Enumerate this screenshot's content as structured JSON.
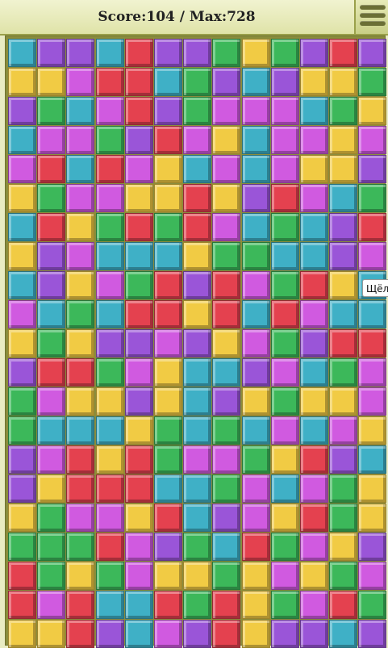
{
  "header": {
    "score_text": "Score:104 / Max:728"
  },
  "menu": {
    "icon": "hamburger-menu-icon"
  },
  "tooltip": {
    "text": "Щёлк"
  },
  "colors": {
    "B": "#3fb0c6",
    "P": "#9a55d8",
    "M": "#d05ae0",
    "R": "#e4414f",
    "G": "#3cb85a",
    "Y": "#f1cb44"
  },
  "board": {
    "columns": 13,
    "rows": 21,
    "grid": [
      "BPPBRPPGYGPRP",
      "YYMRRBGPBPYYG",
      "PGBMRPGMMMBGY",
      "BMMGPRMYBMMYM",
      "MRBRMYBMBMYYP",
      "YGMMYYRYPRMBG",
      "BRYGRGRMBGBPR",
      "YPMBBBYGGBBPM",
      "BPYMGRPRMGRYB",
      "MBGBRRYRBRMBB",
      "YGYPPMPYMGPRR",
      "PRRGMYBBPMBGM",
      "GMYYPYBPYGYYM",
      "GBBBYGBGBMBMY",
      "PMRYRGMMGYRPB",
      "PYRRRBBGMBMGY",
      "YGMMYRBPMYRGY",
      "GGGRMPGBRGMYP",
      "RGYGMYYGYMYGM",
      "RMRBBRGRYGMRG",
      "YYRPBMPRYPPBP"
    ]
  }
}
